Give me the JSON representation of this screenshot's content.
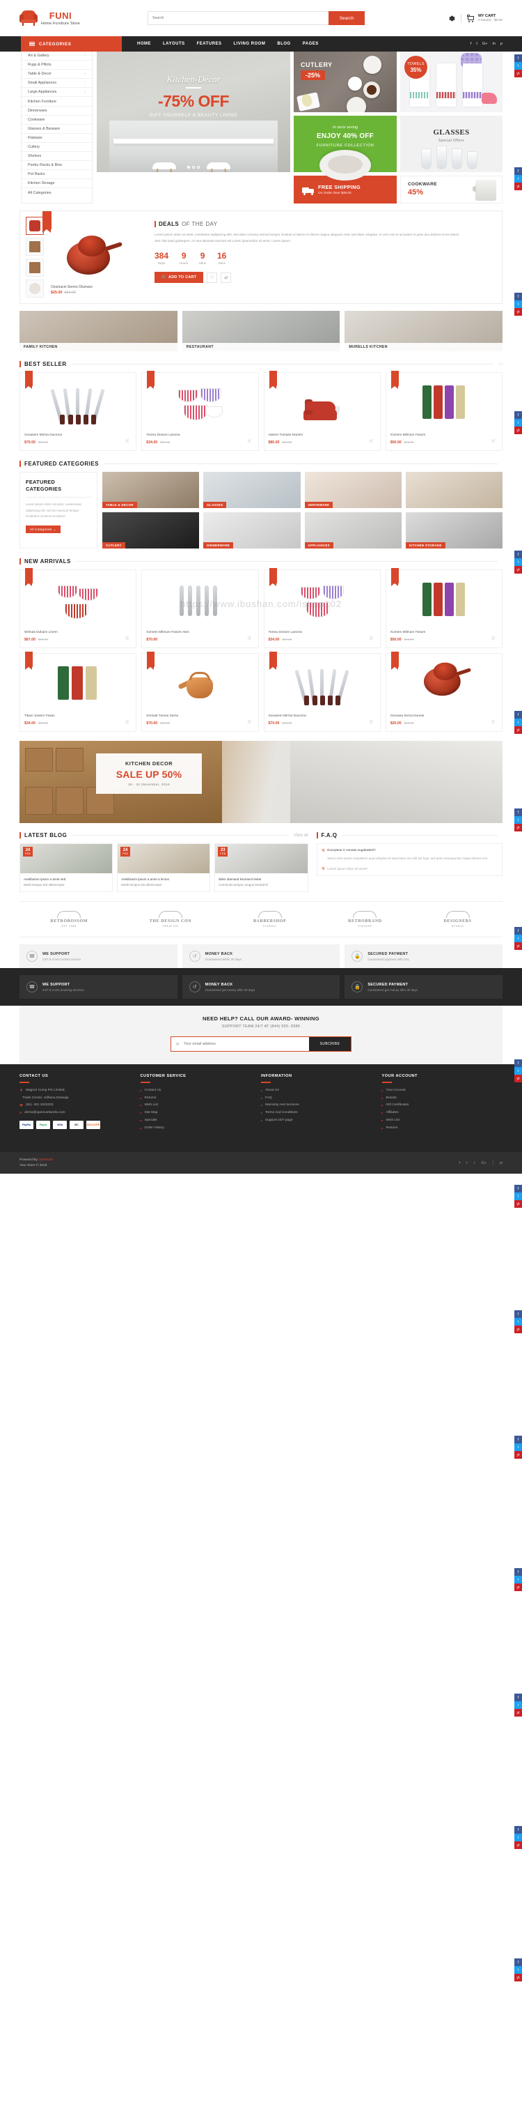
{
  "header": {
    "brand": "FUNI",
    "tagline": "Home Furniture Store",
    "search_placeholder": "Search",
    "search_button": "Search",
    "cart_title": "MY CART",
    "cart_sub": "0 item(s) - $0.00"
  },
  "nav": {
    "categories_label": "CATEGORIES",
    "items": [
      "HOME",
      "LAYOUTS",
      "FEATURES",
      "LIVING ROOM",
      "BLOG",
      "PAGES"
    ],
    "social": [
      "f",
      "t",
      "G+",
      "in",
      "p"
    ]
  },
  "sidebar": {
    "items": [
      {
        "label": "Art & Gallery",
        "arrow": "›"
      },
      {
        "label": "Rugs & Pillots",
        "arrow": ""
      },
      {
        "label": "Table & Decor",
        "arrow": "›"
      },
      {
        "label": "Small Appliances",
        "arrow": "›"
      },
      {
        "label": "Large Appliances",
        "arrow": "›"
      },
      {
        "label": "Kitchen Furniture",
        "arrow": ""
      },
      {
        "label": "Dinnerware",
        "arrow": ""
      },
      {
        "label": "Cookware",
        "arrow": ""
      },
      {
        "label": "Glasses & Barware",
        "arrow": ""
      },
      {
        "label": "Flatware",
        "arrow": ""
      },
      {
        "label": "Cutlery",
        "arrow": ""
      },
      {
        "label": "Shelves",
        "arrow": ""
      },
      {
        "label": "Pantry Racks & Bins",
        "arrow": ""
      },
      {
        "label": "Pot Racks",
        "arrow": ""
      },
      {
        "label": "Kitchen Storage",
        "arrow": ""
      },
      {
        "label": "All Categories",
        "arrow": ""
      }
    ]
  },
  "hero": {
    "script": "Kitchen-Décor",
    "discount": "-75% OFF",
    "subtitle": "GIFT YOURSELF A BEAUTY LIVING"
  },
  "promos": {
    "cutlery_title": "CUTLERY",
    "cutlery_badge": "-25%",
    "towels_label": "TOWELS",
    "towels_pct": "35%",
    "enjoy_small": "in store saving",
    "enjoy_big": "ENJOY 40% OFF",
    "enjoy_sub": "FURNITURE COLLECTION",
    "glasses_title": "GLASSES",
    "glasses_sub": "Special Offers",
    "freeship_title": "FREE SHIPPING",
    "freeship_sub": "On Order Over $49.00",
    "cookware_title": "COOKWARE",
    "cookware_pct": "45%"
  },
  "deals": {
    "title": "DEALS",
    "title_rest": "OF THE DAY",
    "description": "Lorem ipsum dolor sit amet, consetetur sadipscing elitr, sed diam nonumy eirmod tempor invidunt ut labore et dolore magna aliquyam erat, sed diam voluptua. At vero eos et accusam et justo duo dolores et ea rebum. Stet clita kasd gubergren, no sea takimata sanctus est Lorem ipsumdolor sit amet, Lorem ipsum.",
    "timer": [
      {
        "value": "384",
        "label": "Days"
      },
      {
        "value": "9",
        "label": "Hours"
      },
      {
        "value": "9",
        "label": "Mins"
      },
      {
        "value": "16",
        "label": "Secs"
      }
    ],
    "add_to_cart": "ADD TO CART",
    "product_name": "Ozumacin Sermo Olumace",
    "product_price": "$25.00",
    "product_old": "$50.00",
    "nav_prev": "‹",
    "nav_next": "›"
  },
  "trio": [
    {
      "label": "FAMILY KITCHEN"
    },
    {
      "label": "RESTAURANT"
    },
    {
      "label": "MURELLS KITCHEN"
    }
  ],
  "best_seller": {
    "heading": "BEST SELLER",
    "products": [
      {
        "name": "Sooasem Mirrsa Dacoma",
        "price": "$70.00",
        "old": "$90.00"
      },
      {
        "name": "Tomsu Dosom Laroma",
        "price": "$34.00",
        "old": "$90.00"
      },
      {
        "name": "Vasem Tumase Danem",
        "price": "$85.00",
        "old": "$90.00"
      },
      {
        "name": "Xomem Milmum Fasom",
        "price": "$50.00",
        "old": "$90.00"
      }
    ]
  },
  "featured": {
    "heading": "FEATURED CATEGORIES",
    "box_title": "FEATURED CATEGORIES",
    "box_text": "Lorem ipsum dolor sit amet, consectetur adipiscing elit, sed do eiusmod tempor incididunt ut labore et dolore.",
    "all_categories": "All Categories →",
    "cells": [
      "TABLE & DECOR",
      "GLASSES",
      "SERVEWARE",
      "",
      "CUTLERY",
      "DINNERWARE",
      "APPLIANCES",
      "KITCHEN STORAGE"
    ]
  },
  "new_arrivals": {
    "heading": "NEW ARRIVALS",
    "row1": [
      {
        "name": "Wilmas Dukaim Linem",
        "price": "$67.00",
        "old": "$90.00"
      },
      {
        "name": "Xomem Milmum Fasom Aten",
        "price": "$70.00",
        "old": ""
      },
      {
        "name": "Tomsu Dosom Laroma",
        "price": "$34.00",
        "old": "$90.00"
      },
      {
        "name": "Xomem Milmum Fasom",
        "price": "$50.00",
        "old": "$90.00"
      }
    ],
    "row2": [
      {
        "name": "Tikam Sasem Fasan",
        "price": "$34.00",
        "old": "$90.00"
      },
      {
        "name": "Smosat Tumas Sama",
        "price": "$70.00",
        "old": "$90.00"
      },
      {
        "name": "Sooasem Mirrsa Dacoma",
        "price": "$70.00",
        "old": "$90.00"
      },
      {
        "name": "Oumasa Sema Dumas",
        "price": "$25.00",
        "old": "$50.00"
      }
    ]
  },
  "watermark": "https://www.ibushan.com/ishop102",
  "kitchen_banner": {
    "title": "KITCHEN DECOR",
    "sale": "SALE UP 50%",
    "dates": "18 - 31 December, 2016"
  },
  "blog": {
    "heading": "LATEST BLOG",
    "view_all": "View all",
    "posts": [
      {
        "day": "24",
        "month": "FEB",
        "title": "Aestibulum ipsum a amet sed",
        "excerpt": "Morbi tempus nisi ullamcorper"
      },
      {
        "day": "24",
        "month": "FEB",
        "title": "Aestibulum ipsum a amet a lectus",
        "excerpt": "Morbi tempus nisi ullamcorper"
      },
      {
        "day": "23",
        "month": "FEB",
        "title": "Bilen diamand ksonsent lester",
        "excerpt": "Commodo tempor congue lacotsd kl"
      }
    ]
  },
  "faq": {
    "heading": "F.A.Q",
    "items": [
      {
        "q": "Q",
        "question": "Excepteur it nonsas sugabatteii?",
        "answer": "Nemo enim ipsam voluptatem quia voluptas sit aspernatur aut odit aut fugit, sed quia consequuntur magni dolores eos."
      },
      {
        "q": "Q",
        "question": "Lorem ipsum dolor sit amet?",
        "answer": ""
      }
    ]
  },
  "brands": [
    {
      "name": "RETROBOSSOM",
      "sub": "EST 1985"
    },
    {
      "name": "THE DESIGN CON",
      "sub": "CREATIVE"
    },
    {
      "name": "BARBERSHOP",
      "sub": "CLASSIC"
    },
    {
      "name": "RETROBRAND",
      "sub": "VINTAGE"
    },
    {
      "name": "DESIGNERS",
      "sub": "STUDIO"
    }
  ],
  "support_light": [
    {
      "title": "WE SUPPORT",
      "sub": "24/7 & cross-contact service",
      "icon": "headset-icon"
    },
    {
      "title": "MONEY BACK",
      "sub": "Guaranteed within 30 days",
      "icon": "refresh-icon"
    },
    {
      "title": "SECURED PAYMENT",
      "sub": "Guaranteed payment with SSL",
      "icon": "lock-icon"
    }
  ],
  "support_dark": [
    {
      "title": "WE SUPPORT",
      "sub": "24/7 & cross-amazing services",
      "icon": "headset-icon"
    },
    {
      "title": "MONEY BACK",
      "sub": "Guaranteed get money after 30 days",
      "icon": "refresh-icon"
    },
    {
      "title": "SECURED PAYMENT",
      "sub": "Guaranteed get money after 30 days",
      "icon": "lock-icon"
    }
  ],
  "newsletter": {
    "line1": "NEED HELP? CALL OUR AWARD- WINNING",
    "line2": "SUPPORT TEAM 24/7 AT (844) 555- 8386",
    "placeholder": "Your email address",
    "button": "SUBCRIBE"
  },
  "footer": {
    "contact": {
      "title": "CONTACT US",
      "items": [
        "Magnor Comp Pvt Limited,",
        "Trade Centre, Udhana Darwaja",
        "(91)- 261 3023333",
        "demo@opencartworks.com"
      ]
    },
    "customer_service": {
      "title": "CUSTOMER SERVICE",
      "items": [
        "Contact Us",
        "Returns",
        "Wish List",
        "Site Map",
        "Specials",
        "Order History"
      ]
    },
    "information": {
      "title": "INFORMATION",
      "items": [
        "About Us",
        "FAQ",
        "Warranty And Services",
        "Terms And Conditions",
        "Support 24/7 page"
      ]
    },
    "account": {
      "title": "YOUR ACCOUNT",
      "items": [
        "Your Account",
        "Brands",
        "Gift Certificates",
        "Affiliates",
        "Wish List",
        "Returns"
      ]
    },
    "payments": [
      "PayPal",
      "Payza",
      "VISA",
      "MC",
      "DISCOVER"
    ]
  },
  "bottom": {
    "powered_prefix": "Powered By ",
    "powered_brand": "OpenCart",
    "copyright": "Your Store © 2018",
    "socials": [
      "f",
      "t",
      "r",
      "G+",
      "yt"
    ]
  },
  "floaters": [
    "f",
    "t",
    "yt"
  ]
}
